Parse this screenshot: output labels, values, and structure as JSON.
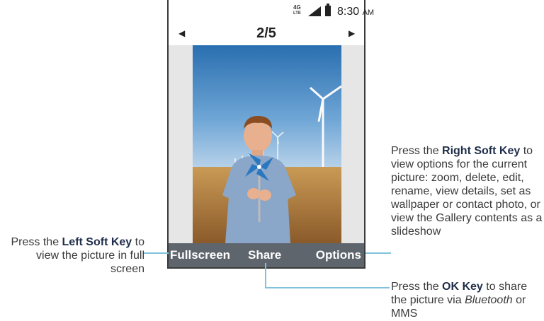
{
  "status_bar": {
    "network_main": "4G",
    "network_sub": "LTE",
    "signal_icon": "signal-icon",
    "battery_icon": "battery-icon",
    "time": "8:30",
    "time_suffix": "AM"
  },
  "navigation": {
    "prev_icon": "chevron-left-icon",
    "next_icon": "chevron-right-icon",
    "counter": "2/5"
  },
  "photo": {
    "description_icon": "photo-boy-with-pinwheel"
  },
  "softkeys": {
    "left": "Fullscreen",
    "center": "Share",
    "right": "Options"
  },
  "callouts": {
    "left": {
      "prefix": "Press the ",
      "key": "Left Soft Key",
      "text": " to view the picture in full screen"
    },
    "right": {
      "prefix": "Press the ",
      "key": "Right Soft Key",
      "text": " to view options for the current picture: zoom, delete, edit, rename, view details, set as wallpaper or contact photo, or view the Gallery contents as a slideshow"
    },
    "ok": {
      "prefix": "Press the ",
      "key": "OK Key",
      "text": " to share the picture via ",
      "italic": "Bluetooth",
      "suffix": " or MMS"
    }
  },
  "colors": {
    "softkey_bar": "#5e656d",
    "callout_line": "#7fc3da",
    "key_text": "#1f2d4a"
  }
}
